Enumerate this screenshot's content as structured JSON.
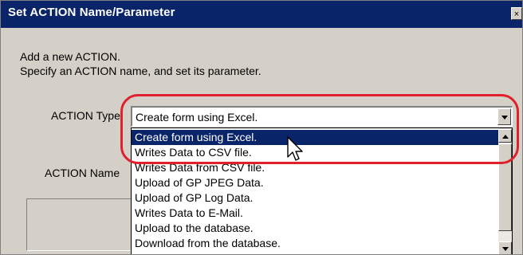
{
  "dialog": {
    "title": "Set ACTION Name/Parameter",
    "close_glyph": "×",
    "description_line1": "Add a new ACTION.",
    "description_line2": "Specify an ACTION name, and set its parameter."
  },
  "action_type": {
    "label": "ACTION Type",
    "selected_value": "Create form using Excel."
  },
  "action_name": {
    "label": "ACTION Name"
  },
  "dropdown_list": {
    "items": [
      "Create form using Excel.",
      "Writes Data to CSV file.",
      "Writes Data from CSV file.",
      "Upload of GP JPEG Data.",
      "Upload of GP Log Data.",
      "Writes Data to E-Mail.",
      "Upload to the database.",
      "Download from the database."
    ],
    "highlighted_index": 0
  },
  "colors": {
    "title_bar": "#0a246a",
    "dialog_bg": "#d4d0c8",
    "selection": "#0a246a",
    "annotation": "#e0202a"
  },
  "icons": {
    "close": "close-icon",
    "dropdown": "chevron-down-icon",
    "scroll_up": "arrow-up-icon",
    "scroll_down": "arrow-down-icon",
    "pointer": "mouse-pointer-icon"
  }
}
